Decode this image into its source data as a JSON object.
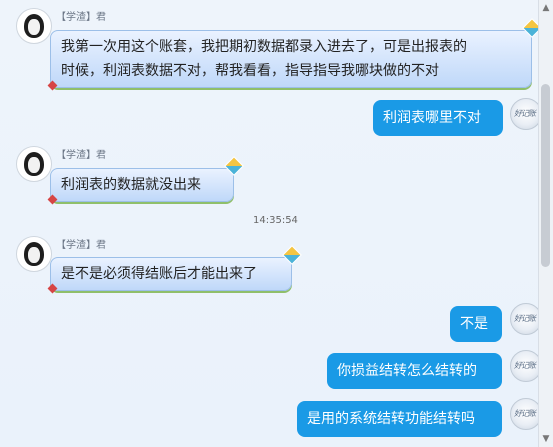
{
  "messages": {
    "m1": {
      "sender": "【学渣】君",
      "line1": "我第一次用这个账套，我把期初数据都录入进去了，可是出报表的",
      "line2": "时候，利润表数据不对，帮我看看，指导指导我哪块做的不对"
    },
    "m2": {
      "text": "利润表哪里不对"
    },
    "m3": {
      "sender": "【学渣】君",
      "text": "利润表的数据就没出来"
    },
    "time": "14:35:54",
    "m4": {
      "sender": "【学渣】君",
      "text": "是不是必须得结账后才能出来了"
    },
    "m5": {
      "text": "不是"
    },
    "m6": {
      "text": "你损益结转怎么结转的"
    },
    "m7": {
      "text": "是用的系统结转功能结转吗"
    }
  },
  "avatars": {
    "self_icon": "user-avatar-icon",
    "agent_icon": "agent-avatar-icon"
  },
  "colors": {
    "outgoing_bubble": "#1a9ae6",
    "incoming_bubble": "#bfd8f9",
    "timestamp": "#666666"
  }
}
